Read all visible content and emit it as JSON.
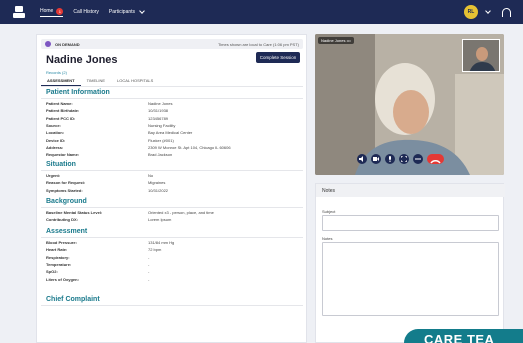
{
  "nav": {
    "home": "Home",
    "home_badge": "1",
    "call_history": "Call History",
    "participants": "Participants",
    "user_initials": "RL"
  },
  "patient": {
    "status": "ON DEMAND",
    "time_note": "Times shown are local to Care (1:06 pm PST)",
    "name": "Nadine Jones",
    "records": "Records (2)",
    "complete_button": "Complete Session",
    "tabs": [
      "ASSESSMENT",
      "TIMELINE",
      "LOCAL HOSPITALS"
    ]
  },
  "sections": {
    "info": "Patient Information",
    "situation": "Situation",
    "background": "Background",
    "assessment": "Assessment",
    "chief": "Chief Complaint"
  },
  "info_rows": [
    {
      "k": "Patient Name:",
      "v": "Nadine Jones"
    },
    {
      "k": "Patient Birthdate:",
      "v": "10/31/1938"
    },
    {
      "k": "Patient PCC ID:",
      "v": "123456789"
    },
    {
      "k": "Source:",
      "v": "Nursing Facility"
    },
    {
      "k": "Location:",
      "v": "Bay Area Medical Center"
    },
    {
      "k": "Device ID:",
      "v": "Fluxker (#001)"
    },
    {
      "k": "Address:",
      "v": "2309 W Monroe St. Apt 104, Chicago IL 60606"
    },
    {
      "k": "Requestor Name:",
      "v": "Brad Jackson"
    }
  ],
  "situation_rows": [
    {
      "k": "Urgent:",
      "v": "No"
    },
    {
      "k": "Reason for Request:",
      "v": "Migraines"
    },
    {
      "k": "Symptoms Started:",
      "v": "10/31/2022"
    }
  ],
  "background_rows": [
    {
      "k": "Baseline Mental Status Level:",
      "v": "Oriented x3 - person, place, and time"
    },
    {
      "k": "Contributing DX:",
      "v": "Lorem Ipsum"
    }
  ],
  "assessment_rows": [
    {
      "k": "Blood Pressure:",
      "v": "131/84 mm Hg"
    },
    {
      "k": "Heart Rate:",
      "v": "72 bpm"
    },
    {
      "k": "Respiratory:",
      "v": "-"
    },
    {
      "k": "Temperature:",
      "v": "-"
    },
    {
      "k": "SpO2:",
      "v": "-"
    },
    {
      "k": "Liters of Oxygen:",
      "v": "-"
    }
  ],
  "video": {
    "name_tag": "Nadine Jones •••"
  },
  "notes": {
    "title": "Notes",
    "subject_label": "Subject",
    "notes_label": "Notes"
  },
  "banner": {
    "text": "CARE TEA"
  },
  "colors": {
    "nav_bg": "#1e2a55",
    "accent_teal": "#1a7a8c",
    "hangup_red": "#e53935",
    "avatar_yellow": "#e6c233"
  }
}
